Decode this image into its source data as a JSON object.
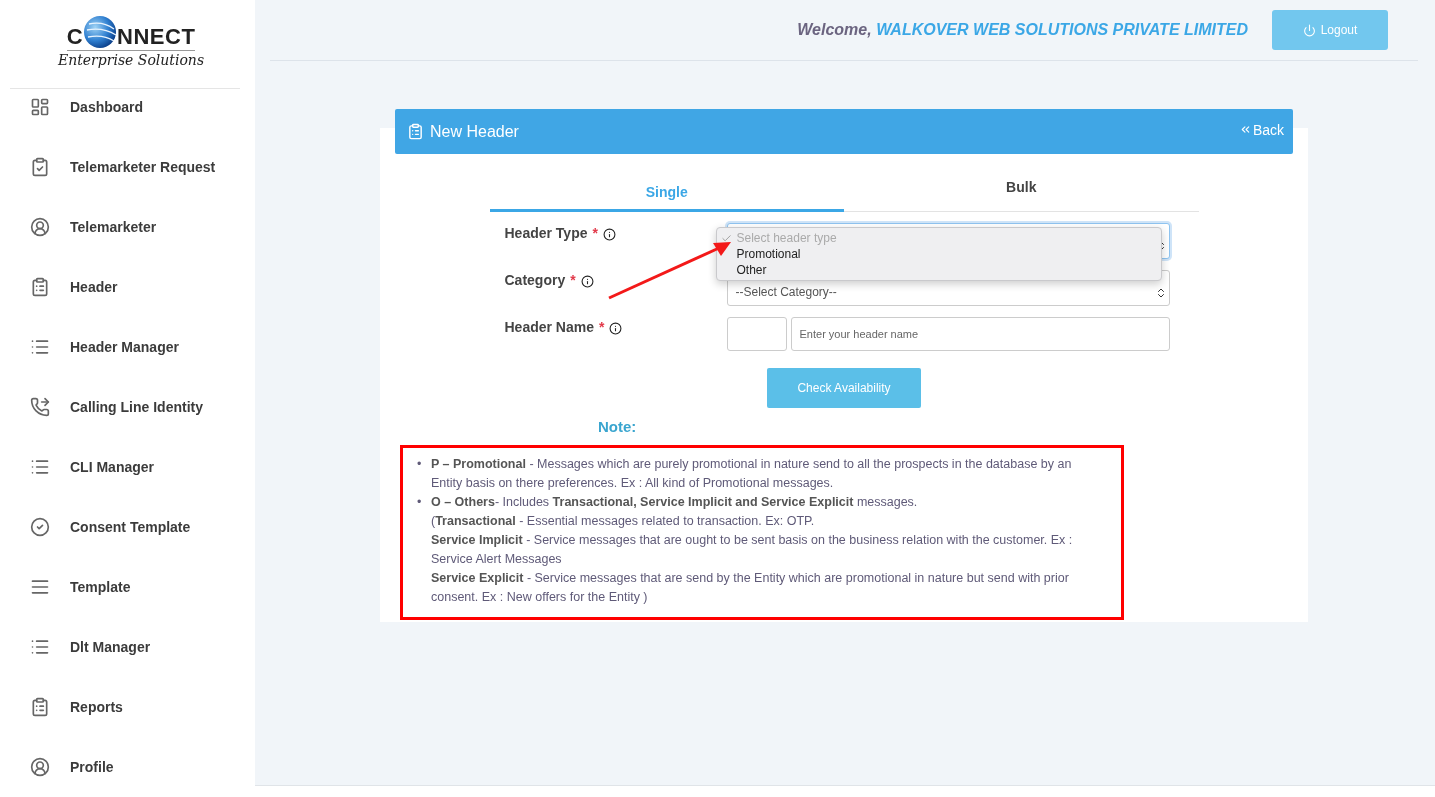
{
  "logo": {
    "prefix": "C",
    "suffix": "NNECT",
    "tagline": "Enterprise Solutions"
  },
  "sidebar": {
    "items": [
      {
        "label": "Dashboard",
        "kind": "dashboard"
      },
      {
        "label": "Telemarketer Request",
        "kind": "clipboard-check"
      },
      {
        "label": "Telemarketer",
        "kind": "user"
      },
      {
        "label": "Header",
        "kind": "clipboard"
      },
      {
        "label": "Header Manager",
        "kind": "list"
      },
      {
        "label": "Calling Line Identity",
        "kind": "phone"
      },
      {
        "label": "CLI Manager",
        "kind": "list"
      },
      {
        "label": "Consent Template",
        "kind": "check-circle"
      },
      {
        "label": "Template",
        "kind": "lines"
      },
      {
        "label": "Dlt Manager",
        "kind": "list"
      },
      {
        "label": "Reports",
        "kind": "clipboard"
      },
      {
        "label": "Profile",
        "kind": "user"
      }
    ]
  },
  "topbar": {
    "welcome": "Welcome,",
    "company": "WALKOVER WEB SOLUTIONS PRIVATE LIMITED",
    "logout": "Logout"
  },
  "panel": {
    "title": "New Header",
    "back": "Back",
    "tabs": [
      {
        "label": "Single",
        "selected": true
      },
      {
        "label": "Bulk",
        "selected": false
      }
    ],
    "fields": [
      {
        "kind": "select",
        "label": "Header Type",
        "required_mark": "*",
        "open": true,
        "options": [
          {
            "label": "Select header type",
            "selected": true,
            "disabled": true
          },
          {
            "label": "Promotional",
            "selected": false,
            "disabled": false
          },
          {
            "label": "Other",
            "selected": false,
            "disabled": false
          }
        ]
      },
      {
        "kind": "select",
        "label": "Category",
        "required_mark": "*",
        "value": "--Select Category--",
        "open": false
      },
      {
        "kind": "prefixed-input",
        "label": "Header Name",
        "required_mark": "*",
        "placeholder": "Enter your header name"
      }
    ],
    "check_button": "Check Availability",
    "note_title": "Note:",
    "notes": [
      {
        "bullet": "•",
        "lines": [
          "**P – Promotional** - Messages which are purely promotional in nature send to all the prospects in the database by an Entity basis on there preferences. Ex : All kind of Promotional messages."
        ]
      },
      {
        "bullet": "•",
        "lines": [
          "**O – Others**- Includes **Transactional, Service Implicit and Service Explicit** messages.",
          "(**Transactional** - Essential messages related to transaction. Ex: OTP.",
          "**Service Implicit** - Service messages that are ought to be sent basis on the business relation with the customer. Ex : Service Alert Messages",
          "**Service Explicit** - Service messages that are send by the Entity which are promotional in nature but send with prior consent. Ex : New offers for the Entity )"
        ]
      }
    ]
  }
}
